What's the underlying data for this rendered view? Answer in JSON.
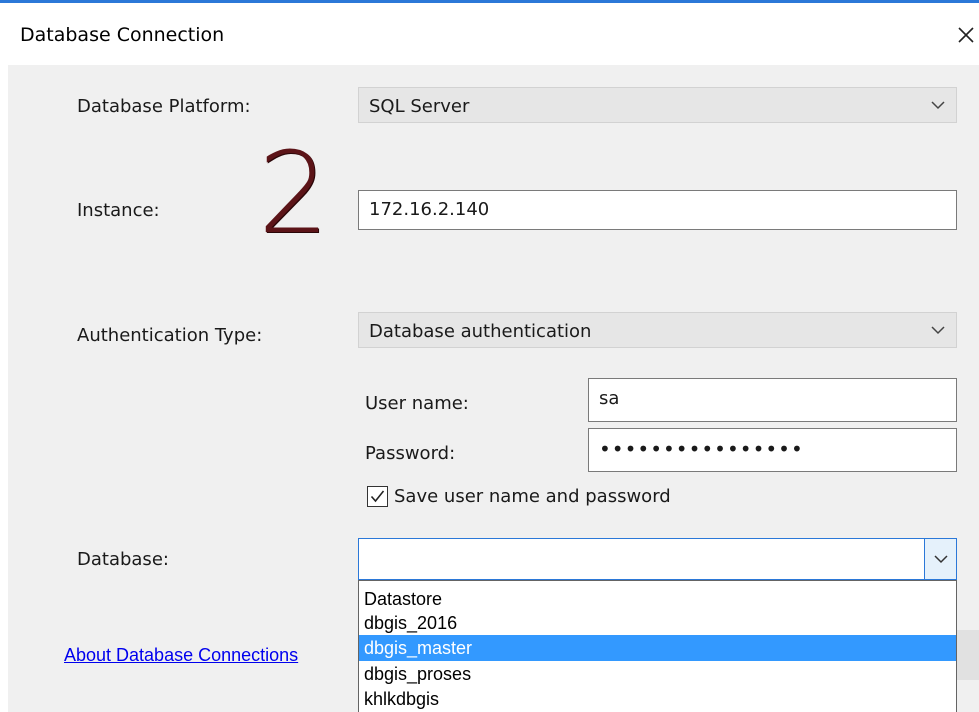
{
  "window": {
    "title": "Database Connection",
    "close_icon": "close-icon",
    "accent_color": "#2b78d8"
  },
  "form": {
    "platform": {
      "label": "Database Platform:",
      "value": "SQL Server"
    },
    "instance": {
      "label": "Instance:",
      "value": "172.16.2.140"
    },
    "annotation": "2",
    "auth": {
      "label": "Authentication Type:",
      "value": "Database authentication"
    },
    "username": {
      "label": "User name:",
      "value": "sa"
    },
    "password": {
      "label": "Password:",
      "value": "••••••••••••••••"
    },
    "save_credentials": {
      "label": "Save user name and password",
      "checked": true
    },
    "database": {
      "label": "Database:",
      "value": "",
      "options": [
        "Datastore",
        "dbgis_2016",
        "dbgis_master",
        "dbgis_proses",
        "khlkdbgis"
      ],
      "highlighted": "dbgis_master"
    }
  },
  "links": {
    "about": "About Database Connections"
  }
}
